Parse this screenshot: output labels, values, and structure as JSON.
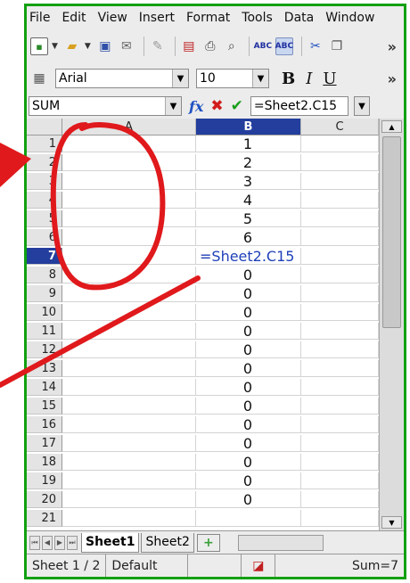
{
  "menu": {
    "file": "File",
    "edit": "Edit",
    "view": "View",
    "insert": "Insert",
    "format": "Format",
    "tools": "Tools",
    "data": "Data",
    "window": "Window"
  },
  "toolbar": {
    "more": "»"
  },
  "format_bar": {
    "font_name": "Arial",
    "font_size": "10",
    "bold": "B",
    "italic": "I",
    "underline": "U",
    "more": "»"
  },
  "formula_bar": {
    "name_box": "SUM",
    "fx": "fx",
    "formula": "=Sheet2.C15"
  },
  "grid": {
    "columns": [
      "A",
      "B",
      "C"
    ],
    "active_column": "B",
    "active_row": "7",
    "rows": [
      {
        "n": "1",
        "b": "1"
      },
      {
        "n": "2",
        "b": "2"
      },
      {
        "n": "3",
        "b": "3"
      },
      {
        "n": "4",
        "b": "4"
      },
      {
        "n": "5",
        "b": "5"
      },
      {
        "n": "6",
        "b": "6"
      },
      {
        "n": "7",
        "b": "=Sheet2.C15"
      },
      {
        "n": "8",
        "b": "0"
      },
      {
        "n": "9",
        "b": "0"
      },
      {
        "n": "10",
        "b": "0"
      },
      {
        "n": "11",
        "b": "0"
      },
      {
        "n": "12",
        "b": "0"
      },
      {
        "n": "13",
        "b": "0"
      },
      {
        "n": "14",
        "b": "0"
      },
      {
        "n": "15",
        "b": "0"
      },
      {
        "n": "16",
        "b": "0"
      },
      {
        "n": "17",
        "b": "0"
      },
      {
        "n": "18",
        "b": "0"
      },
      {
        "n": "19",
        "b": "0"
      },
      {
        "n": "20",
        "b": "0"
      },
      {
        "n": "21",
        "b": ""
      }
    ]
  },
  "tabs": {
    "sheet1": "Sheet1",
    "sheet2": "Sheet2"
  },
  "status": {
    "sheet": "Sheet 1 / 2",
    "style": "Default",
    "sum": "Sum=7"
  },
  "annotation_color": "#e0191c"
}
